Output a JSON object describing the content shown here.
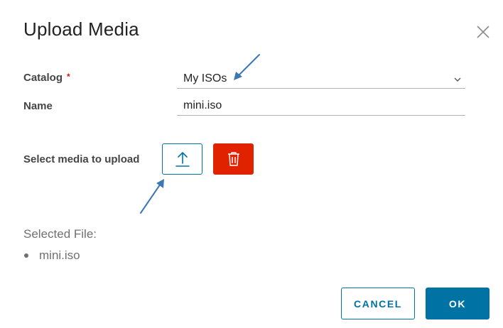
{
  "dialog": {
    "title": "Upload Media"
  },
  "form": {
    "catalog_label": "Catalog",
    "required_marker": "*",
    "catalog_value": "My ISOs",
    "name_label": "Name",
    "name_value": "mini.iso",
    "select_media_label": "Select media to upload"
  },
  "selected": {
    "label": "Selected File:",
    "files": [
      "mini.iso"
    ]
  },
  "footer": {
    "cancel_label": "CANCEL",
    "ok_label": "OK"
  },
  "icons": {
    "close": "close-icon",
    "chevron": "chevron-down-icon",
    "upload": "upload-icon",
    "delete": "trash-icon"
  },
  "colors": {
    "primary": "#0072a3",
    "danger": "#e12200",
    "annotation_arrow": "#3c78b4"
  }
}
